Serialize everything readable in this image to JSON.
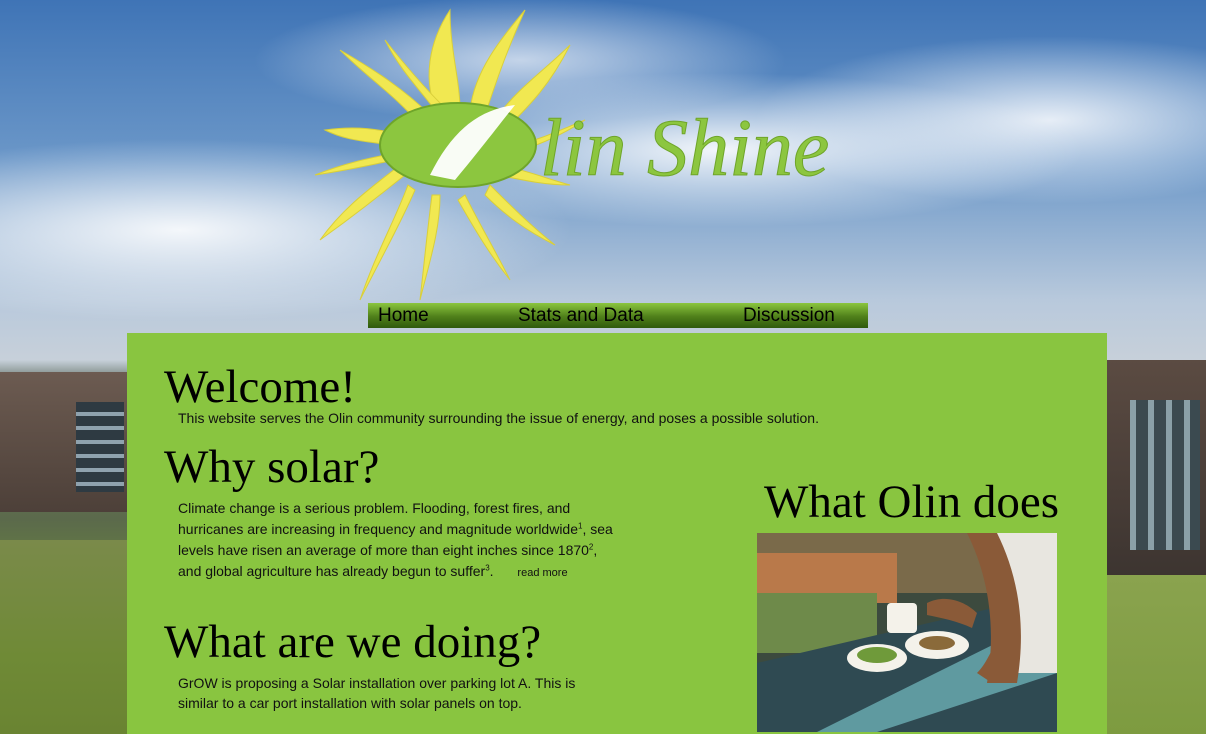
{
  "logo": {
    "text": "lin Shine"
  },
  "nav": {
    "items": [
      "Home",
      "Stats and Data",
      "Discussion"
    ]
  },
  "welcome": {
    "title": "Welcome!",
    "text": "This website serves the Olin community surrounding the issue of energy, and poses a possible solution."
  },
  "why_solar": {
    "title": "Why solar?",
    "text_1": "Climate change is a serious problem. Flooding, forest fires, and hurricanes are increasing in frequency and magnitude worldwide",
    "ref_1": "1",
    "text_2": ", sea levels have risen an average of more than eight inches since 1870",
    "ref_2": "2",
    "text_3": ", and global agriculture has already begun to suffer",
    "ref_3": "3",
    "text_4": ".",
    "read_more": "read more"
  },
  "doing": {
    "title": "What are we doing?",
    "text": "GrOW is proposing a Solar installation over parking lot A. This is similar to a car port installation with solar panels on top."
  },
  "olin_does": {
    "title": "What Olin does"
  },
  "colors": {
    "panel": "#89c540",
    "logo_green": "#8cc63f",
    "sun_yellow": "#f4ea5a"
  }
}
